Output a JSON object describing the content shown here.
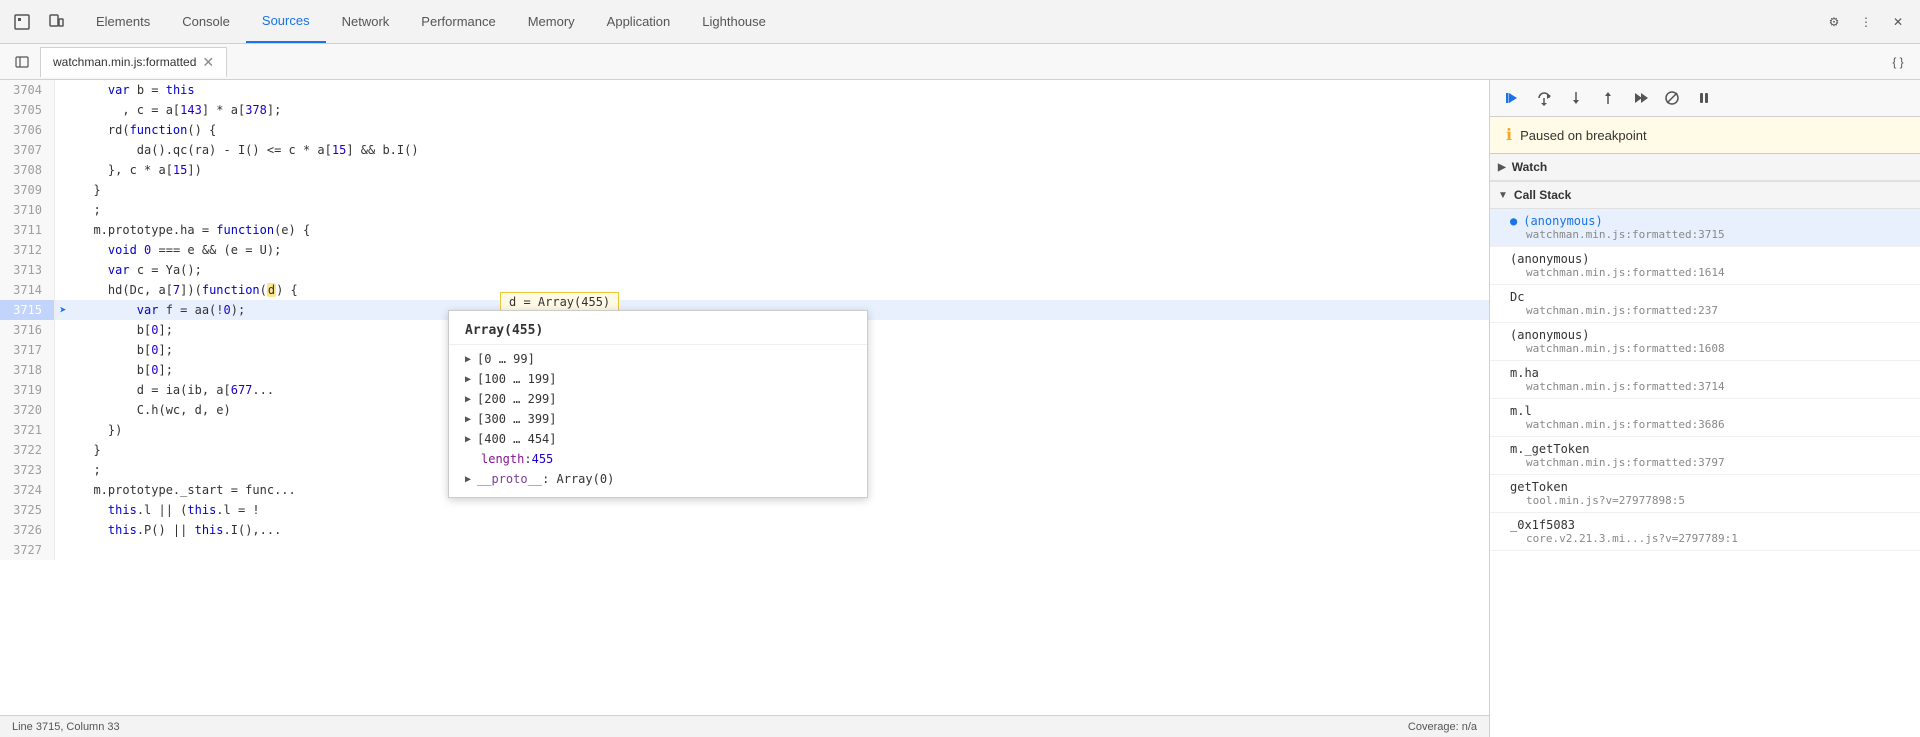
{
  "topBar": {
    "tabs": [
      {
        "label": "Elements",
        "active": false
      },
      {
        "label": "Console",
        "active": false
      },
      {
        "label": "Sources",
        "active": true
      },
      {
        "label": "Network",
        "active": false
      },
      {
        "label": "Performance",
        "active": false
      },
      {
        "label": "Memory",
        "active": false
      },
      {
        "label": "Application",
        "active": false
      },
      {
        "label": "Lighthouse",
        "active": false
      }
    ],
    "settingsIcon": "⚙",
    "moreIcon": "⋮",
    "closeIcon": "✕"
  },
  "fileBar": {
    "fileName": "watchman.min.js:formatted",
    "closeIcon": "✕",
    "formatIcon": "{ }"
  },
  "debugBar": {
    "pauseResumeIcon": "▶",
    "stepOverIcon": "↷",
    "stepIntoIcon": "↓",
    "stepOutIcon": "↑",
    "continueIcon": "→→",
    "deactivateIcon": "◉",
    "pauseOnExceptionIcon": "⏸"
  },
  "pausedBanner": {
    "icon": "ℹ",
    "text": "Paused on breakpoint"
  },
  "watch": {
    "label": "Watch",
    "collapsed": true,
    "arrowIcon": "▶"
  },
  "callStack": {
    "label": "Call Stack",
    "collapsed": false,
    "arrowIcon": "▼",
    "items": [
      {
        "name": "(anonymous)",
        "file": "watchman.min.js:formatted:3715",
        "active": true
      },
      {
        "name": "(anonymous)",
        "file": "watchman.min.js:formatted:1614",
        "active": false
      },
      {
        "name": "Dc",
        "file": "watchman.min.js:formatted:237",
        "active": false
      },
      {
        "name": "(anonymous)",
        "file": "watchman.min.js:formatted:1608",
        "active": false
      },
      {
        "name": "m.ha",
        "file": "watchman.min.js:formatted:3714",
        "active": false
      },
      {
        "name": "m.l",
        "file": "watchman.min.js:formatted:3686",
        "active": false
      },
      {
        "name": "m._getToken",
        "file": "watchman.min.js:formatted:3797",
        "active": false
      },
      {
        "name": "getToken",
        "file": "tool.min.js?v=27977898:5",
        "active": false
      },
      {
        "name": "_0x1f5083",
        "file": "core.v2.21.3.mi...js?v=2797789:1",
        "active": false
      }
    ]
  },
  "code": {
    "lines": [
      {
        "num": "3704",
        "code": "    var b = this",
        "highlighted": false
      },
      {
        "num": "3705",
        "code": "      , c = a[143] * a[378];",
        "highlighted": false
      },
      {
        "num": "3706",
        "code": "    rd(function() {",
        "highlighted": false
      },
      {
        "num": "3707",
        "code": "        da().qc(ra) - I() <= c * a[15] && b.I()",
        "highlighted": false
      },
      {
        "num": "3708",
        "code": "    }, c * a[15])",
        "highlighted": false
      },
      {
        "num": "3709",
        "code": "  }",
        "highlighted": false
      },
      {
        "num": "3710",
        "code": "  ;",
        "highlighted": false
      },
      {
        "num": "3711",
        "code": "  m.prototype.ha = function(e) {",
        "highlighted": false
      },
      {
        "num": "3712",
        "code": "    void 0 === e && (e = U);",
        "highlighted": false
      },
      {
        "num": "3713",
        "code": "    var c = Ya();",
        "highlighted": false
      },
      {
        "num": "3714",
        "code": "    hd(Dc, a[7])(function(d) {   d = Array(455)",
        "highlighted": false
      },
      {
        "num": "3715",
        "code": "        var f = aa(!0);",
        "highlighted": true,
        "breakpoint": true
      },
      {
        "num": "3716",
        "code": "        b[0];",
        "highlighted": false
      },
      {
        "num": "3717",
        "code": "        b[0];",
        "highlighted": false
      },
      {
        "num": "3718",
        "code": "        b[0];",
        "highlighted": false
      },
      {
        "num": "3719",
        "code": "        d = ia(ib, a[677...",
        "highlighted": false
      },
      {
        "num": "3720",
        "code": "        C.h(wc, d, e)",
        "highlighted": false
      },
      {
        "num": "3721",
        "code": "    })",
        "highlighted": false
      },
      {
        "num": "3722",
        "code": "  }",
        "highlighted": false
      },
      {
        "num": "3723",
        "code": "  ;",
        "highlighted": false
      },
      {
        "num": "3724",
        "code": "  m.prototype._start = func...",
        "highlighted": false
      },
      {
        "num": "3725",
        "code": "    this.l || (this.l = ...",
        "highlighted": false
      },
      {
        "num": "3726",
        "code": "    this.P() || this.I(),...",
        "highlighted": false
      },
      {
        "num": "3727",
        "code": "",
        "highlighted": false
      }
    ]
  },
  "tooltip": {
    "title": "Array(455)",
    "items": [
      {
        "label": "[0 … 99]",
        "arrow": true
      },
      {
        "label": "[100 … 199]",
        "arrow": true
      },
      {
        "label": "[200 … 299]",
        "arrow": true
      },
      {
        "label": "[300 … 399]",
        "arrow": true
      },
      {
        "label": "[400 … 454]",
        "arrow": true
      },
      {
        "label": "length: 455",
        "arrow": false
      },
      {
        "label": "__proto__: Array(0)",
        "arrow": true
      }
    ]
  },
  "inlineTooltip": {
    "text": "d = Array(455)"
  },
  "statusBar": {
    "left": "Line 3715, Column 33",
    "right": "Coverage: n/a"
  }
}
